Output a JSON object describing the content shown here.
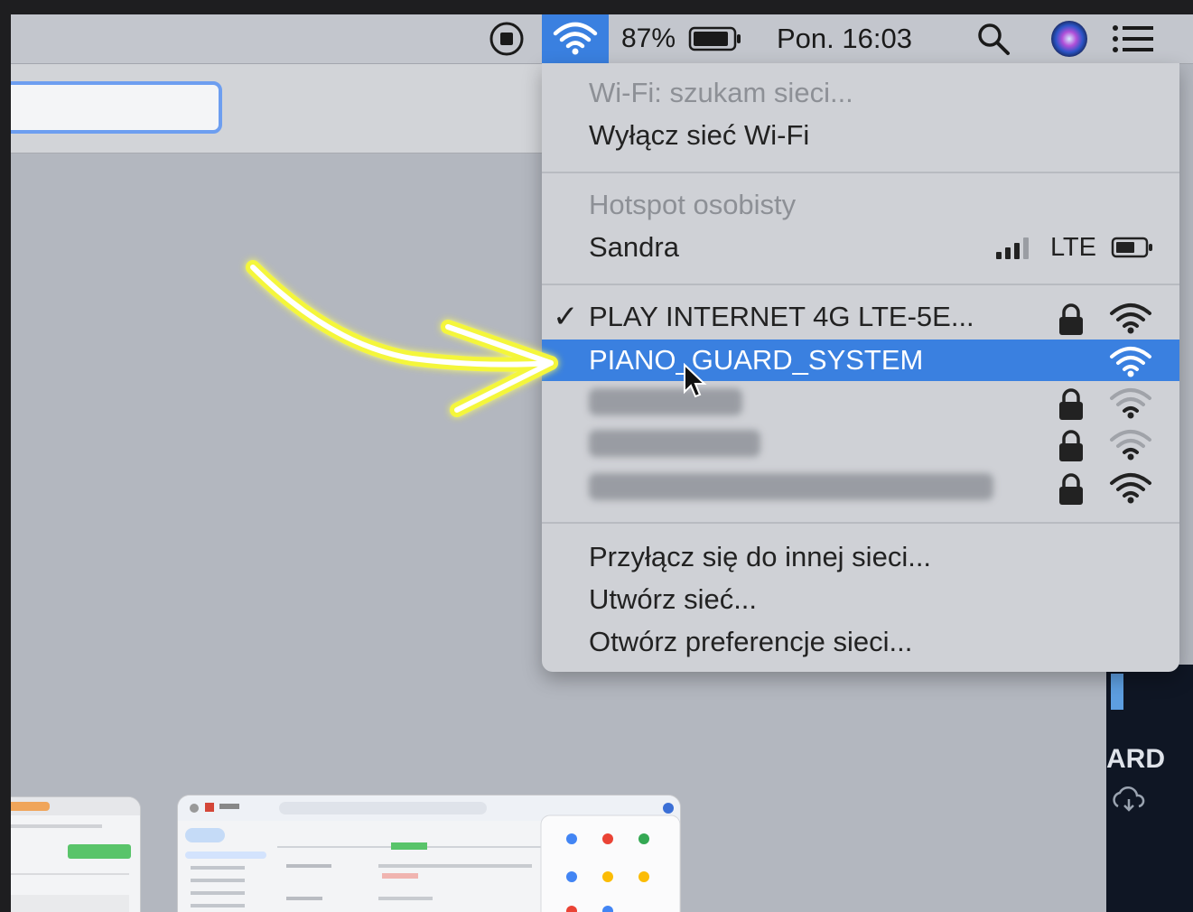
{
  "menubar": {
    "battery_percent": "87%",
    "clock": "Pon. 16:03",
    "icons": [
      "screen-record-icon",
      "wifi-icon",
      "battery-icon",
      "search-icon",
      "siri-icon",
      "control-center-icon"
    ]
  },
  "wifi_menu": {
    "status": "Wi-Fi: szukam sieci...",
    "turn_off": "Wyłącz sieć Wi-Fi",
    "hotspot_header": "Hotspot osobisty",
    "hotspot_device": "Sandra",
    "hotspot_network_type": "LTE",
    "connected_network": "PLAY INTERNET 4G LTE-5E...",
    "highlighted_network": "PIANO_GUARD_SYSTEM",
    "join_other": "Przyłącz się do innej sieci...",
    "create_network": "Utwórz sieć...",
    "open_preferences": "Otwórz preferencje sieci..."
  },
  "background": {
    "right_panel_text": "ARD"
  },
  "colors": {
    "accent": "#3a80e0",
    "highlight_arrow": "#f4f63a"
  }
}
